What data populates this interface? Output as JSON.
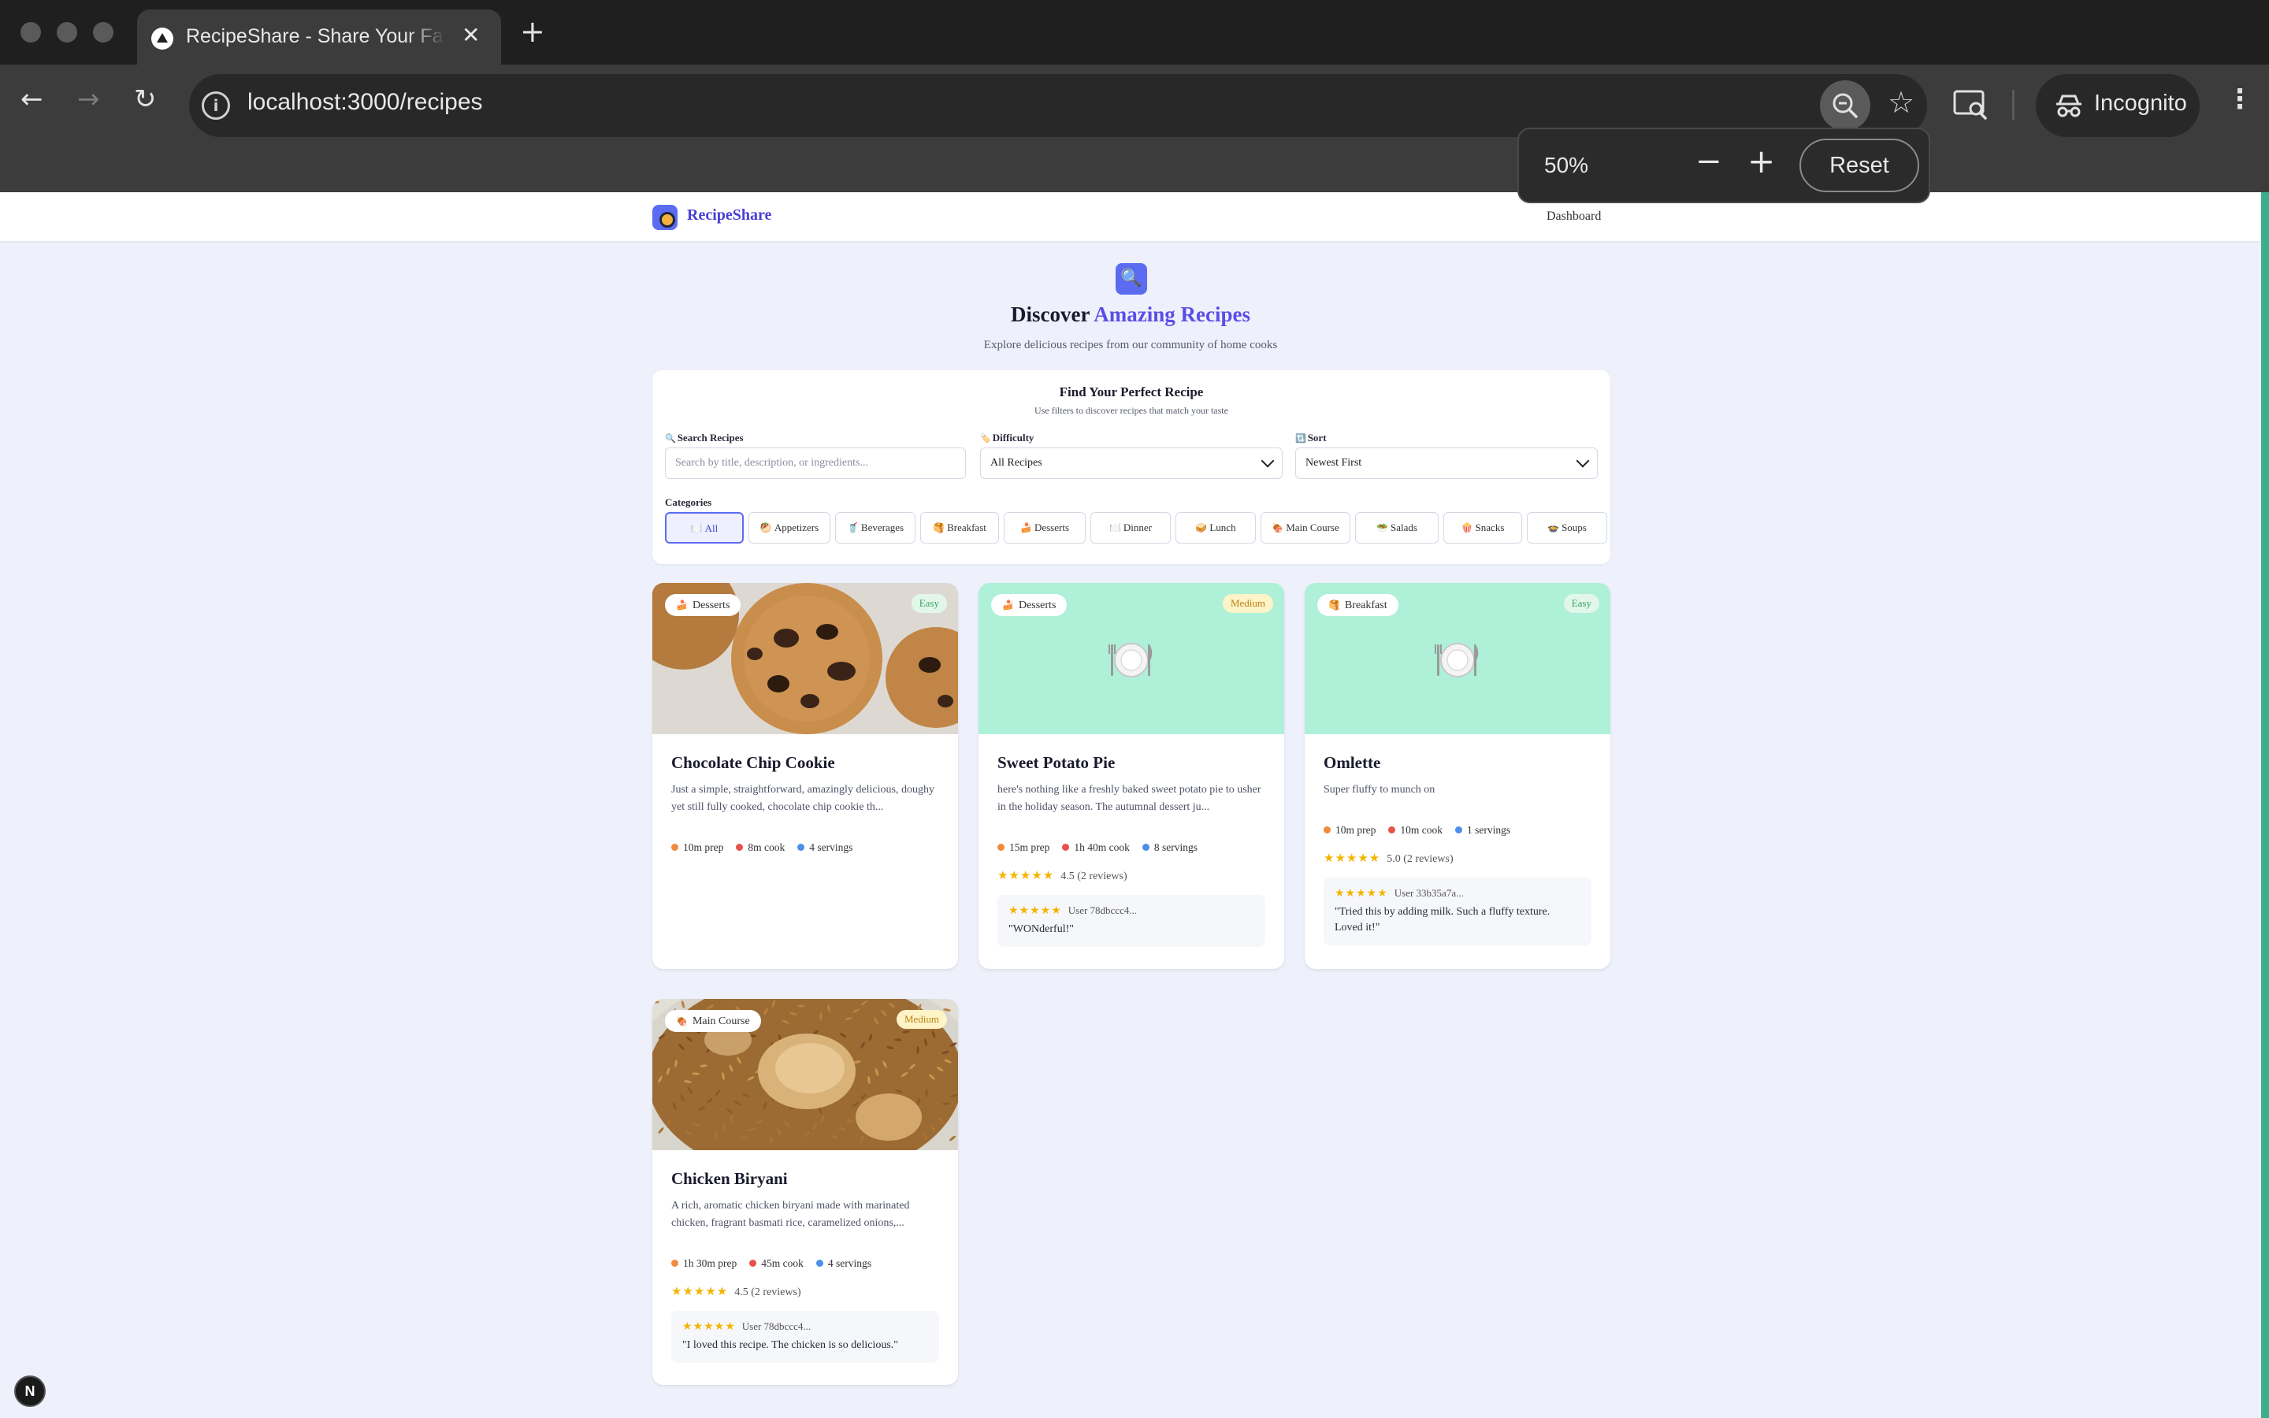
{
  "browser": {
    "tab_title": "RecipeShare - Share Your Favorite Recipes",
    "url": "localhost:3000/recipes",
    "profile_label": "Incognito",
    "zoom": {
      "level": "50%",
      "reset_label": "Reset"
    }
  },
  "app": {
    "logo_text": "RecipeShare",
    "nav_dashboard": "Dashboard"
  },
  "hero": {
    "title_plain": "Discover",
    "title_accent": "Amazing Recipes",
    "subtitle": "Explore delicious recipes from our community of home cooks"
  },
  "filters": {
    "title": "Find Your Perfect Recipe",
    "subtitle": "Use filters to discover recipes that match your taste",
    "search_label": "Search Recipes",
    "search_placeholder": "Search by title, description, or ingredients...",
    "difficulty_label": "Difficulty",
    "difficulty_value": "All Recipes",
    "sort_label": "Sort",
    "sort_value": "Newest First",
    "categories_label": "Categories",
    "categories": [
      {
        "label": "All",
        "icon": "🍽️"
      },
      {
        "label": "Appetizers",
        "icon": "🥙"
      },
      {
        "label": "Beverages",
        "icon": "🥤"
      },
      {
        "label": "Breakfast",
        "icon": "🥞"
      },
      {
        "label": "Desserts",
        "icon": "🍰"
      },
      {
        "label": "Dinner",
        "icon": "🍽️"
      },
      {
        "label": "Lunch",
        "icon": "🥪"
      },
      {
        "label": "Main Course",
        "icon": "🍖"
      },
      {
        "label": "Salads",
        "icon": "🥗"
      },
      {
        "label": "Snacks",
        "icon": "🍿"
      },
      {
        "label": "Soups",
        "icon": "🍲"
      }
    ],
    "active_category": "All"
  },
  "recipes": [
    {
      "title": "Chocolate Chip Cookie",
      "category": "Desserts",
      "category_icon": "🍰",
      "difficulty": "Easy",
      "description": "Just a simple, straightforward, amazingly delicious, doughy yet still fully cooked, chocolate chip cookie th...",
      "prep": "10m prep",
      "cook": "8m cook",
      "servings": "4 servings",
      "image": "cookie-photo"
    },
    {
      "title": "Sweet Potato Pie",
      "category": "Desserts",
      "category_icon": "🍰",
      "difficulty": "Medium",
      "description": "here's nothing like a freshly baked sweet potato pie to usher in the holiday season. The autumnal dessert ju...",
      "prep": "15m prep",
      "cook": "1h 40m cook",
      "servings": "8 servings",
      "stars": "★★★★★",
      "rating": "4.5 (2 reviews)",
      "review_user": "User 78dbccc4...",
      "review_text": "\"WONderful!\"",
      "image": "placeholder-plate"
    },
    {
      "title": "Omlette",
      "category": "Breakfast",
      "category_icon": "🥞",
      "difficulty": "Easy",
      "description": "Super fluffy to munch on",
      "prep": "10m prep",
      "cook": "10m cook",
      "servings": "1 servings",
      "stars": "★★★★★",
      "rating": "5.0 (2 reviews)",
      "review_user": "User 33b35a7a...",
      "review_text": "\"Tried this by adding milk. Such a fluffy texture. Loved it!\"",
      "image": "placeholder-plate"
    },
    {
      "title": "Chicken Biryani",
      "category": "Main Course",
      "category_icon": "🍖",
      "difficulty": "Medium",
      "description": "A rich, aromatic chicken biryani made with marinated chicken, fragrant basmati rice, caramelized onions,...",
      "prep": "1h 30m prep",
      "cook": "45m cook",
      "servings": "4 servings",
      "stars": "★★★★★",
      "rating": "4.5 (2 reviews)",
      "review_user": "User 78dbccc4...",
      "review_text": "\"I loved this recipe. The chicken is so delicious.\"",
      "image": "biryani-photo"
    }
  ],
  "dev_badge": "N",
  "colors": {
    "accent": "#5b6cf0",
    "accent_text": "#5b4ee6",
    "prep_dot": "#f08a3c",
    "cook_dot": "#e8524a",
    "servings_dot": "#4a8fe8"
  }
}
